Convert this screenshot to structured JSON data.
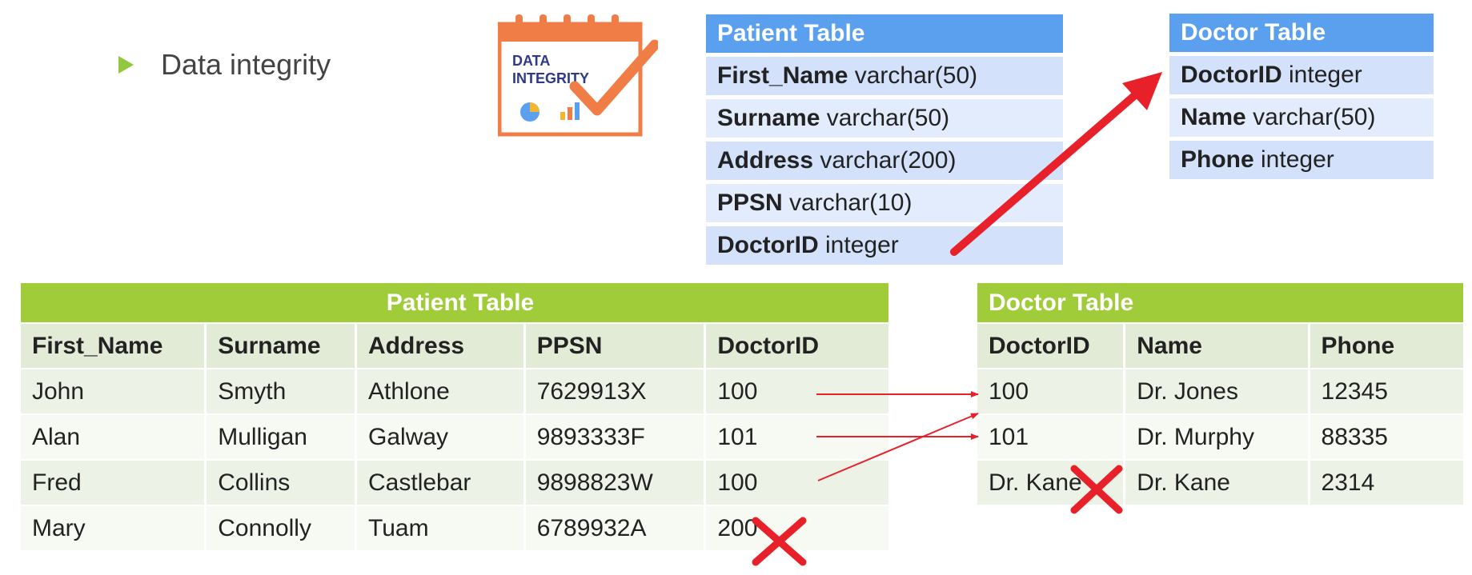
{
  "bullet": {
    "text": "Data integrity"
  },
  "logo": {
    "line1": "DATA",
    "line2": "INTEGRITY"
  },
  "schema_patient": {
    "title": "Patient Table",
    "fields": [
      {
        "name": "First_Name",
        "type": "varchar(50)"
      },
      {
        "name": "Surname",
        "type": "varchar(50)"
      },
      {
        "name": "Address",
        "type": "varchar(200)"
      },
      {
        "name": "PPSN",
        "type": "varchar(10)"
      },
      {
        "name": "DoctorID",
        "type": "integer"
      }
    ]
  },
  "schema_doctor": {
    "title": "Doctor Table",
    "fields": [
      {
        "name": "DoctorID",
        "type": "integer"
      },
      {
        "name": "Name",
        "type": "varchar(50)"
      },
      {
        "name": "Phone",
        "type": "integer"
      }
    ]
  },
  "patient_table": {
    "title": "Patient Table",
    "headers": [
      "First_Name",
      "Surname",
      "Address",
      "PPSN",
      "DoctorID"
    ],
    "rows": [
      [
        "John",
        "Smyth",
        "Athlone",
        "7629913X",
        "100"
      ],
      [
        "Alan",
        "Mulligan",
        "Galway",
        "9893333F",
        "101"
      ],
      [
        "Fred",
        "Collins",
        "Castlebar",
        "9898823W",
        "100"
      ],
      [
        "Mary",
        "Connolly",
        "Tuam",
        "6789932A",
        "200"
      ]
    ]
  },
  "doctor_table": {
    "title": "Doctor Table",
    "headers": [
      "DoctorID",
      "Name",
      "Phone"
    ],
    "rows": [
      [
        "100",
        "Dr. Jones",
        "12345"
      ],
      [
        "101",
        "Dr. Murphy",
        "88335"
      ],
      [
        "Dr. Kane",
        "Dr. Kane",
        "2314"
      ]
    ]
  },
  "colors": {
    "accent_green": "#a1cc39",
    "schema_blue": "#5aa0ef",
    "error_red": "#e8202a",
    "logo_orange": "#f07d45",
    "logo_navy": "#2e3a87"
  }
}
